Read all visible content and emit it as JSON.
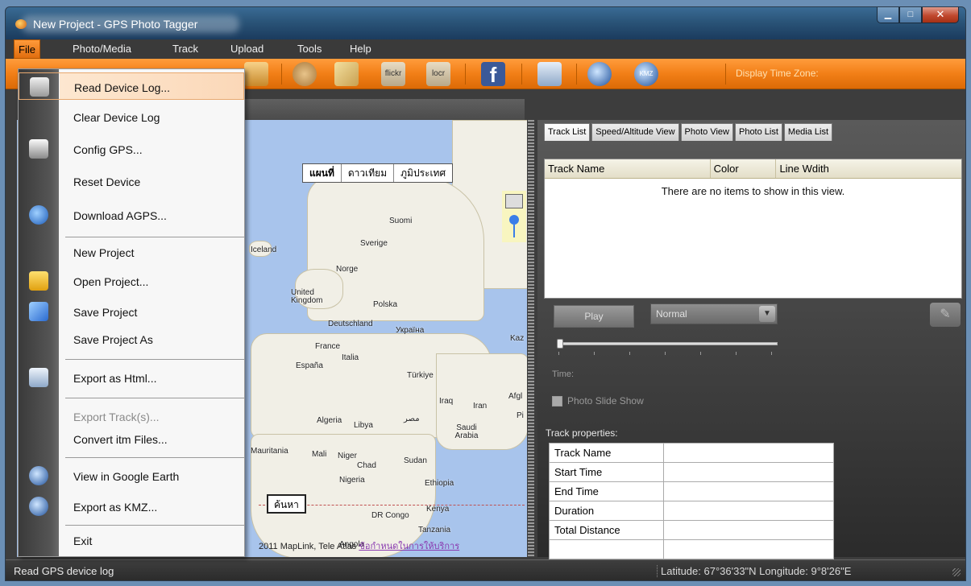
{
  "window": {
    "title": "New Project - GPS Photo Tagger",
    "min": "▁",
    "max": "□",
    "close": "✕"
  },
  "menu": [
    "File",
    "Photo/Media",
    "Track",
    "Upload",
    "Tools",
    "Help"
  ],
  "toolbar": {
    "timezone_label": "Display Time Zone:",
    "flickr": "flickr",
    "locr": "locr",
    "facebook": "f",
    "kmz": "KMZ"
  },
  "file_menu": [
    {
      "label": "Read Device Log...",
      "icon": "read-log-icon"
    },
    {
      "label": "Clear Device Log"
    },
    {
      "label": "Config GPS...",
      "icon": "config-gps-icon"
    },
    {
      "label": "Reset Device"
    },
    {
      "label": "Download AGPS...",
      "icon": "globe-download-icon"
    },
    {
      "label": "New Project"
    },
    {
      "label": "Open Project...",
      "icon": "folder-open-icon"
    },
    {
      "label": "Save Project",
      "icon": "save-icon"
    },
    {
      "label": "Save Project As"
    },
    {
      "label": "Export as Html...",
      "icon": "html-export-icon"
    },
    {
      "label": "Export Track(s)..."
    },
    {
      "label": "Convert itm Files..."
    },
    {
      "label": "View in Google Earth",
      "icon": "google-earth-icon"
    },
    {
      "label": "Export as KMZ...",
      "icon": "kmz-icon"
    },
    {
      "label": "Exit"
    }
  ],
  "map": {
    "types": [
      "แผนที่",
      "ดาวเทียม",
      "ภูมิประเทศ"
    ],
    "search_button": "ค้นหา",
    "copyright": "2011 MapLink, Tele Atlas",
    "terms_link": "ข้อกำหนดในการให้บริการ",
    "labels": [
      "Iceland",
      "Sverige",
      "Suomi",
      "Norge",
      "United Kingdom",
      "Polska",
      "Deutschland",
      "Україна",
      "Kaz",
      "France",
      "Italia",
      "España",
      "Türkiye",
      "Iraq",
      "Iran",
      "Afgl",
      "Pi",
      "Algeria",
      "Libya",
      "مصر",
      "Saudi Arabia",
      "Mauritania",
      "Mali",
      "Niger",
      "Chad",
      "Sudan",
      "Nigeria",
      "Ethiopia",
      "DR Congo",
      "Kenya",
      "Tanzania",
      "Angola"
    ]
  },
  "tabs": [
    "Track List",
    "Speed/Altitude View",
    "Photo View",
    "Photo List",
    "Media List"
  ],
  "track_list": {
    "columns": [
      "Track Name",
      "Color",
      "Line Wdith"
    ],
    "empty": "There are no items to show in this view."
  },
  "player": {
    "play": "Play",
    "speed": "Normal",
    "time_label": "Time:",
    "slideshow": "Photo Slide Show"
  },
  "properties": {
    "title": "Track properties:",
    "rows": [
      "Track Name",
      "Start Time",
      "End Time",
      "Duration",
      "Total Distance"
    ]
  },
  "status": {
    "left": "Read GPS device log",
    "right": "Latitude: 67°36'33\"N  Longitude: 9°8'26\"E"
  }
}
